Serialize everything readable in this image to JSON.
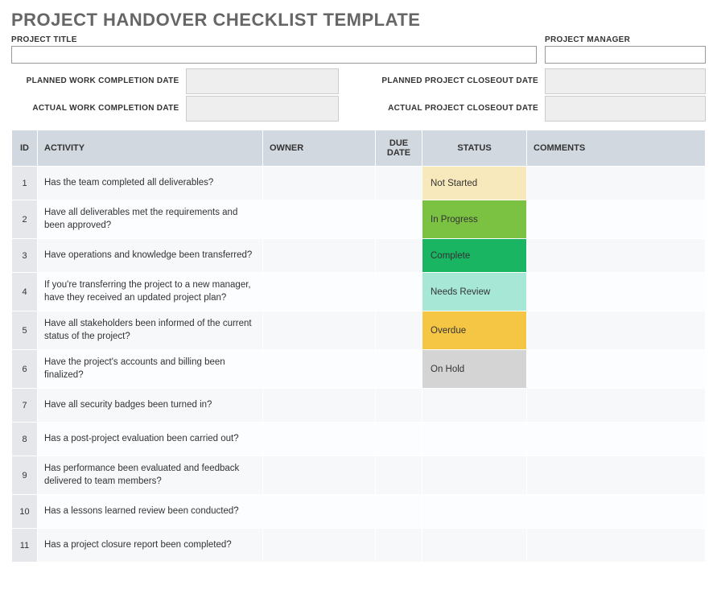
{
  "title": "PROJECT HANDOVER CHECKLIST TEMPLATE",
  "top": {
    "project_title_label": "PROJECT TITLE",
    "project_title_value": "",
    "project_manager_label": "PROJECT MANAGER",
    "project_manager_value": ""
  },
  "dates": {
    "planned_work_label": "PLANNED WORK COMPLETION DATE",
    "actual_work_label": "ACTUAL WORK COMPLETION DATE",
    "planned_closeout_label": "PLANNED PROJECT CLOSEOUT DATE",
    "actual_closeout_label": "ACTUAL PROJECT CLOSEOUT DATE",
    "planned_work_value": "",
    "actual_work_value": "",
    "planned_closeout_value": "",
    "actual_closeout_value": ""
  },
  "headers": {
    "id": "ID",
    "activity": "ACTIVITY",
    "owner": "OWNER",
    "due": "DUE DATE",
    "status": "STATUS",
    "comments": "COMMENTS"
  },
  "status_classes": {
    "Not Started": "status-not-started",
    "In Progress": "status-in-progress",
    "Complete": "status-complete",
    "Needs Review": "status-needs-review",
    "Overdue": "status-overdue",
    "On Hold": "status-on-hold"
  },
  "rows": [
    {
      "id": "1",
      "activity": "Has the team completed all deliverables?",
      "owner": "",
      "due": "",
      "status": "Not Started",
      "comments": ""
    },
    {
      "id": "2",
      "activity": "Have all deliverables met the requirements and been approved?",
      "owner": "",
      "due": "",
      "status": "In Progress",
      "comments": ""
    },
    {
      "id": "3",
      "activity": "Have operations and knowledge been transferred?",
      "owner": "",
      "due": "",
      "status": "Complete",
      "comments": ""
    },
    {
      "id": "4",
      "activity": "If you're transferring the project to a new manager, have they received an updated project plan?",
      "owner": "",
      "due": "",
      "status": "Needs Review",
      "comments": ""
    },
    {
      "id": "5",
      "activity": "Have all stakeholders been informed of the current status of the project?",
      "owner": "",
      "due": "",
      "status": "Overdue",
      "comments": ""
    },
    {
      "id": "6",
      "activity": "Have the project's accounts and billing been finalized?",
      "owner": "",
      "due": "",
      "status": "On Hold",
      "comments": ""
    },
    {
      "id": "7",
      "activity": "Have all security badges been turned in?",
      "owner": "",
      "due": "",
      "status": "",
      "comments": ""
    },
    {
      "id": "8",
      "activity": "Has a post-project evaluation been carried out?",
      "owner": "",
      "due": "",
      "status": "",
      "comments": ""
    },
    {
      "id": "9",
      "activity": "Has performance been evaluated and feedback delivered to team members?",
      "owner": "",
      "due": "",
      "status": "",
      "comments": ""
    },
    {
      "id": "10",
      "activity": "Has a lessons learned review been conducted?",
      "owner": "",
      "due": "",
      "status": "",
      "comments": ""
    },
    {
      "id": "11",
      "activity": "Has a project closure report been completed?",
      "owner": "",
      "due": "",
      "status": "",
      "comments": ""
    }
  ]
}
